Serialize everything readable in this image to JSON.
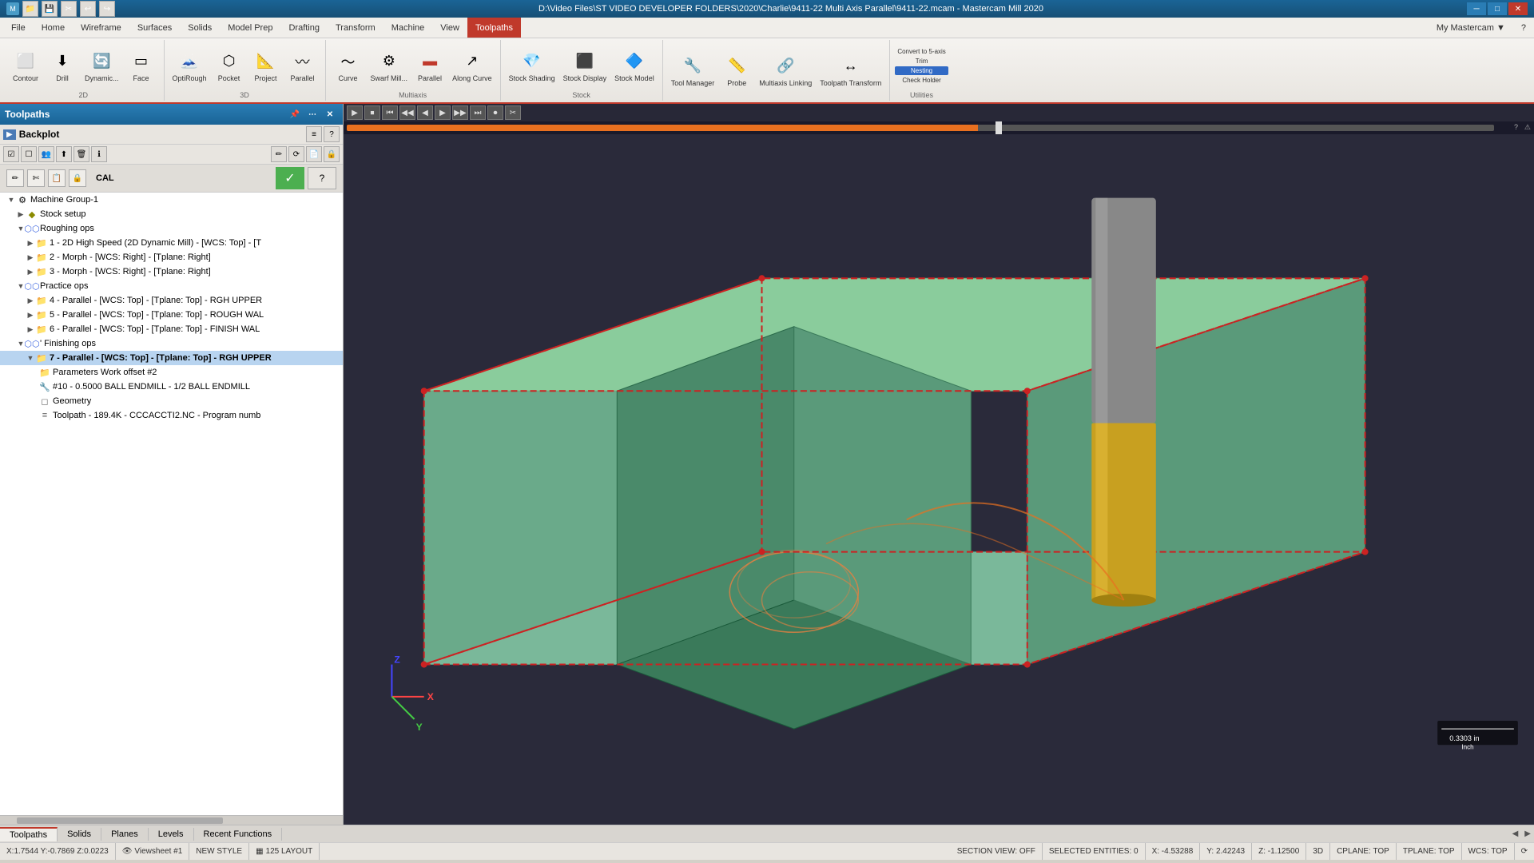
{
  "titlebar": {
    "title": "D:\\Video Files\\ST VIDEO DEVELOPER FOLDERS\\2020\\Charlie\\9411-22 Multi Axis Parallel\\9411-22.mcam - Mastercam Mill 2020",
    "app_icon": "M",
    "controls": [
      "─",
      "□",
      "✕"
    ]
  },
  "menubar": {
    "items": [
      "File",
      "Home",
      "Wireframe",
      "Surfaces",
      "Solids",
      "Model Prep",
      "Drafting",
      "Transform",
      "Machine",
      "View",
      "Toolpaths"
    ],
    "active": "Toolpaths",
    "right_btn": "My Mastercam"
  },
  "ribbon": {
    "groups": [
      {
        "name": "2D",
        "buttons": [
          "Contour",
          "Drill",
          "Dynamic...",
          "Face"
        ]
      },
      {
        "name": "3D",
        "buttons": [
          "OptiRough",
          "Pocket",
          "Project",
          "Parallel"
        ]
      },
      {
        "name": "Multiaxis",
        "buttons": [
          "Curve",
          "Swarf Mill...",
          "Parallel",
          "Along Curve"
        ]
      },
      {
        "name": "Stock",
        "buttons": [
          "Stock Shading",
          "Stock Display",
          "Stock Model"
        ]
      },
      {
        "name": "",
        "buttons": [
          "Tool Manager",
          "Probe",
          "Multiaxis Linking",
          "Toolpath Transform"
        ]
      },
      {
        "name": "Utilities",
        "buttons": [
          "Convert to 5-axis",
          "Trim",
          "Nesting",
          "Check Holder"
        ]
      }
    ]
  },
  "left_panel": {
    "title": "Toolpaths",
    "backplot_label": "Backplot",
    "tree": {
      "nodes": [
        {
          "id": "machine",
          "label": "Machine Group-1",
          "level": 0,
          "type": "machine",
          "expanded": true
        },
        {
          "id": "stock",
          "label": "Stock setup",
          "level": 1,
          "type": "stock",
          "expanded": false
        },
        {
          "id": "roughing",
          "label": "Roughing ops",
          "level": 1,
          "type": "group",
          "expanded": true
        },
        {
          "id": "op1",
          "label": "1 - 2D High Speed (2D Dynamic Mill) - [WCS: Top] - [T",
          "level": 2,
          "type": "op",
          "folder_color": "yellow"
        },
        {
          "id": "op2",
          "label": "2 - Morph - [WCS: Right] - [Tplane: Right]",
          "level": 2,
          "type": "op",
          "folder_color": "yellow"
        },
        {
          "id": "op3",
          "label": "3 - Morph - [WCS: Right] - [Tplane: Right]",
          "level": 2,
          "type": "op",
          "folder_color": "yellow"
        },
        {
          "id": "practice",
          "label": "Practice ops",
          "level": 1,
          "type": "group",
          "expanded": true
        },
        {
          "id": "op4",
          "label": "4 - Parallel - [WCS: Top] - [Tplane: Top] - RGH UPPER",
          "level": 2,
          "type": "op",
          "folder_color": "yellow"
        },
        {
          "id": "op5",
          "label": "5 - Parallel - [WCS: Top] - [Tplane: Top] - ROUGH WAL",
          "level": 2,
          "type": "op",
          "folder_color": "yellow"
        },
        {
          "id": "op6",
          "label": "6 - Parallel - [WCS: Top] - [Tplane: Top] - FINISH WAL",
          "level": 2,
          "type": "op",
          "folder_color": "yellow"
        },
        {
          "id": "finishing",
          "label": "Finishing ops",
          "level": 1,
          "type": "group",
          "expanded": true
        },
        {
          "id": "op7",
          "label": "7 - Parallel - [WCS: Top] - [Tplane: Top] - RGH UPPER",
          "level": 2,
          "type": "op",
          "folder_color": "yellow",
          "selected": true
        },
        {
          "id": "params",
          "label": "Parameters  Work offset #2",
          "level": 3,
          "type": "params"
        },
        {
          "id": "tool",
          "label": "#10 - 0.5000 BALL ENDMILL - 1/2 BALL ENDMILL",
          "level": 3,
          "type": "tool"
        },
        {
          "id": "geom",
          "label": "Geometry",
          "level": 3,
          "type": "geom"
        },
        {
          "id": "toolpath",
          "label": "Toolpath - 189.4K - CCCACCTI2.NC - Program numb",
          "level": 3,
          "type": "toolpath"
        }
      ]
    },
    "cal_label": "CAL",
    "ok_label": "✓",
    "help_label": "?"
  },
  "viewport": {
    "playback_btns": [
      "▶",
      "⏮",
      "◀◀",
      "◀",
      "▶",
      "▶▶",
      "⏭",
      "⏺",
      "✂"
    ],
    "timeline_progress": 55,
    "axes": {
      "x": "X",
      "y": "Y",
      "z": "Z"
    },
    "scale": "0.3303 in\nInch"
  },
  "bottom_tabs": {
    "items": [
      "Toolpaths",
      "Solids",
      "Planes",
      "Levels",
      "Recent Functions"
    ],
    "active": "Toolpaths"
  },
  "statusbar": {
    "coords": "X:1.7544  Y:-0.7869  Z:0.0223",
    "section_view": "SECTION VIEW: OFF",
    "selected": "SELECTED ENTITIES: 0",
    "x_coord": "X: -4.53288",
    "y_coord": "Y: 2.42243",
    "z_coord": "Z: -1.12500",
    "mode": "3D",
    "cplane": "CPLANE: TOP",
    "tplane": "TPLANE: TOP",
    "wcs": "WCS: TOP",
    "viewsheet": "Viewsheet #1",
    "style": "NEW STYLE",
    "layout": "125 LAYOUT"
  }
}
